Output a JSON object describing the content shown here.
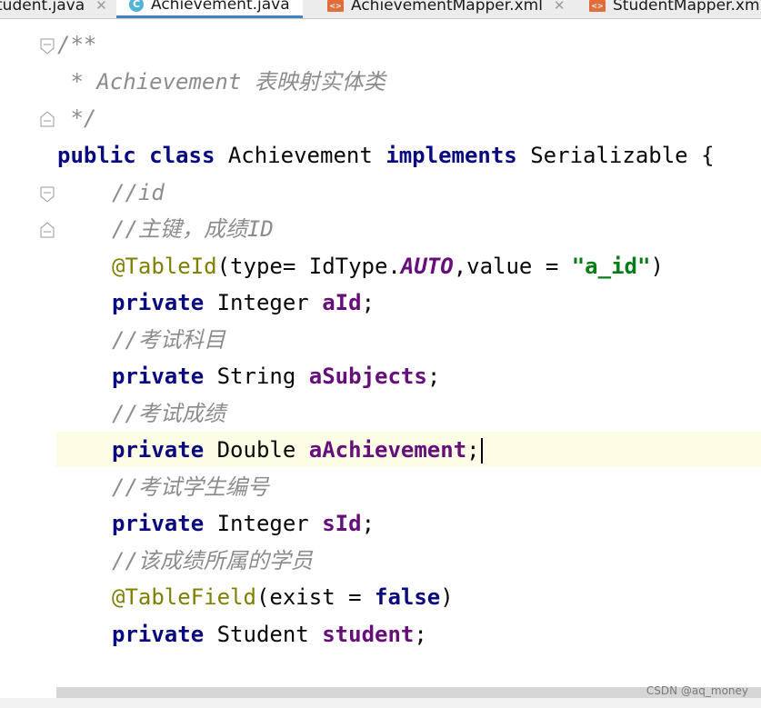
{
  "tabs": [
    {
      "label": "tudent.java",
      "icon": "class-icon",
      "active": false
    },
    {
      "label": "Achievement.java",
      "icon": "class-icon",
      "active": true
    },
    {
      "label": "AchievementMapper.xml",
      "icon": "xml-file-icon",
      "active": false
    },
    {
      "label": "StudentMapper.xml",
      "icon": "xml-file-icon",
      "active": false
    }
  ],
  "tab_icon_glyphs": {
    "class": "C",
    "xml": "<>"
  },
  "code": {
    "doc_open": "/**",
    "doc_line": " * Achievement 表映射实体类",
    "doc_close": " */",
    "class_decl": {
      "kw_public": "public",
      "kw_class": "class",
      "name": "Achievement",
      "kw_implements": "implements",
      "iface": "Serializable",
      "brace": "{"
    },
    "comment_id": "//id",
    "comment_pk": "//主键，成绩ID",
    "table_id": {
      "annotation": "@TableId",
      "open": "(type= IdType.",
      "const": "AUTO",
      "mid": ",value = ",
      "string": "\"a_id\"",
      "close": ")"
    },
    "field_aid": {
      "kw": "private",
      "type": "Integer",
      "name": "aId",
      "end": ";"
    },
    "comment_subjects": "//考试科目",
    "field_subjects": {
      "kw": "private",
      "type": "String",
      "name": "aSubjects",
      "end": ";"
    },
    "comment_score": "//考试成绩",
    "field_achievement": {
      "kw": "private",
      "type": "Double",
      "name": "aAchievement",
      "end": ";"
    },
    "comment_sid": "//考试学生编号",
    "field_sid": {
      "kw": "private",
      "type": "Integer",
      "name": "sId",
      "end": ";"
    },
    "comment_student": "//该成绩所属的学员",
    "table_field": {
      "annotation": "@TableField",
      "open": "(exist = ",
      "kw_false": "false",
      "close": ")"
    },
    "field_student": {
      "kw": "private",
      "type": "Student",
      "name": "student",
      "end": ";"
    }
  },
  "watermark": "CSDN @aq_money",
  "colors": {
    "keyword": "#0a0a80",
    "comment": "#8c8c8c",
    "annotation": "#808000",
    "string": "#067d17",
    "field": "#660e7a",
    "current_line": "#fdfce5",
    "active_tab_underline": "#4083c9"
  }
}
